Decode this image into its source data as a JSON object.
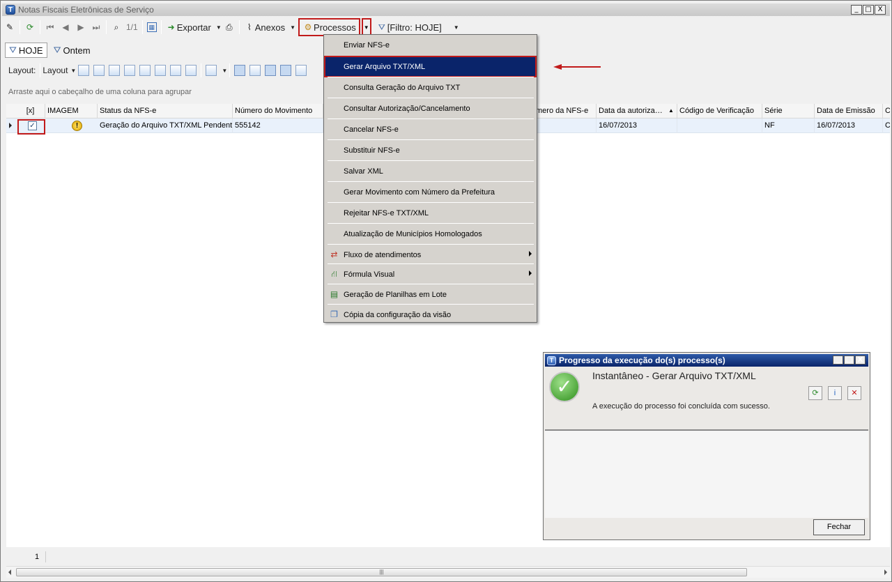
{
  "window": {
    "title": "Notas Fiscais Eletrônicas de Serviço",
    "app_icon": "T",
    "controls": [
      "_",
      "□",
      "X"
    ]
  },
  "toolbar": {
    "page_indicator": "1/1",
    "export_label": "Exportar",
    "attachments_label": "Anexos",
    "processes_label": "Processos",
    "filter_label": "[Filtro: HOJE]"
  },
  "quick_filters": {
    "today_label": "HOJE",
    "yesterday_label": "Ontem"
  },
  "layout_bar": {
    "label": "Layout:",
    "dropdown_label": "Layout"
  },
  "group_hint": "Arraste aqui o cabeçalho de uma coluna para agrupar",
  "grid": {
    "headers": [
      "[x]",
      "IMAGEM",
      "Status da NFS-e",
      "Número do Movimento",
      "mero da NFS-e",
      "Data da autoriza…",
      "Código de Verificação",
      "Série",
      "Data de Emissão",
      "C"
    ],
    "row": {
      "checked": "✓",
      "status": "Geração do Arquivo TXT/XML Pendente",
      "movement": "555142",
      "auth_date": "16/07/2013",
      "series": "NF",
      "emission_date": "16/07/2013",
      "extra": "C"
    }
  },
  "menu": {
    "items": [
      {
        "label": "Enviar NFS-e"
      },
      {
        "label": "Gerar Arquivo TXT/XML"
      },
      {
        "label": "Consulta Geração do Arquivo TXT"
      },
      {
        "label": "Consultar Autorização/Cancelamento"
      },
      {
        "label": "Cancelar NFS-e"
      },
      {
        "label": "Substituir NFS-e"
      },
      {
        "label": "Salvar XML"
      },
      {
        "label": "Gerar Movimento com Número da Prefeitura"
      },
      {
        "label": "Rejeitar NFS-e TXT/XML"
      },
      {
        "label": "Atualização de Municípios Homologados"
      },
      {
        "label": "Fluxo de atendimentos"
      },
      {
        "label": "Fórmula Visual"
      },
      {
        "label": "Geração de Planilhas em Lote"
      },
      {
        "label": "Cópia da configuração da visão"
      }
    ]
  },
  "dialog": {
    "title": "Progresso da execução do(s) processo(s)",
    "heading": "Instantâneo - Gerar Arquivo TXT/XML",
    "message": "A execução do processo foi concluída com sucesso.",
    "close_label": "Fechar"
  },
  "status": {
    "page": "1"
  },
  "colors": {
    "highlight": "#0a246a",
    "annotation_red": "#c11a1a",
    "dialog_title": "#0a246a"
  }
}
